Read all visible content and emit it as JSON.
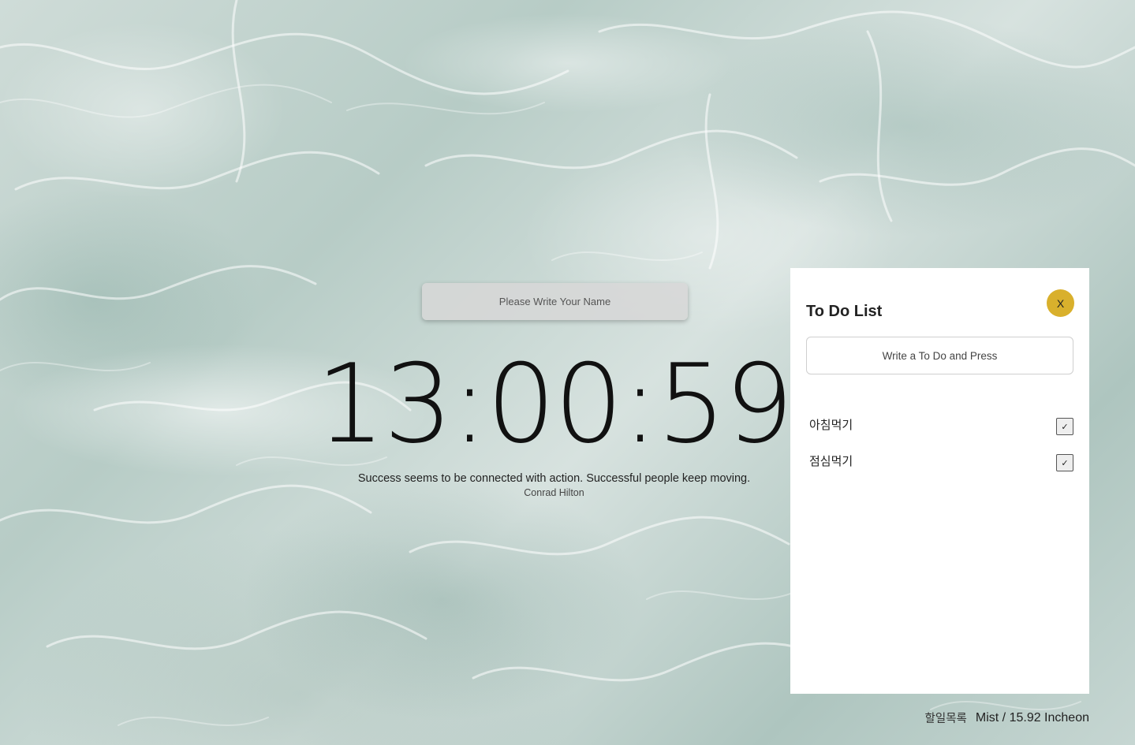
{
  "name_form": {
    "placeholder": "Please Write Your Name",
    "value": ""
  },
  "clock": {
    "time": "13:00:59"
  },
  "quote": {
    "text": "Success seems to be connected with action. Successful people keep moving.",
    "author": "Conrad Hilton"
  },
  "todo": {
    "title": "To Do List",
    "close_label": "X",
    "input_placeholder": "Write a To Do and Press",
    "items": [
      {
        "label": "아침먹기",
        "check_label": "✓"
      },
      {
        "label": "점심먹기",
        "check_label": "✓"
      }
    ]
  },
  "footer": {
    "todo_link": "할일목록",
    "weather": "Mist / 15.92 Incheon"
  },
  "colors": {
    "close_button": "#d9b02c",
    "panel_background": "#ffffff"
  }
}
